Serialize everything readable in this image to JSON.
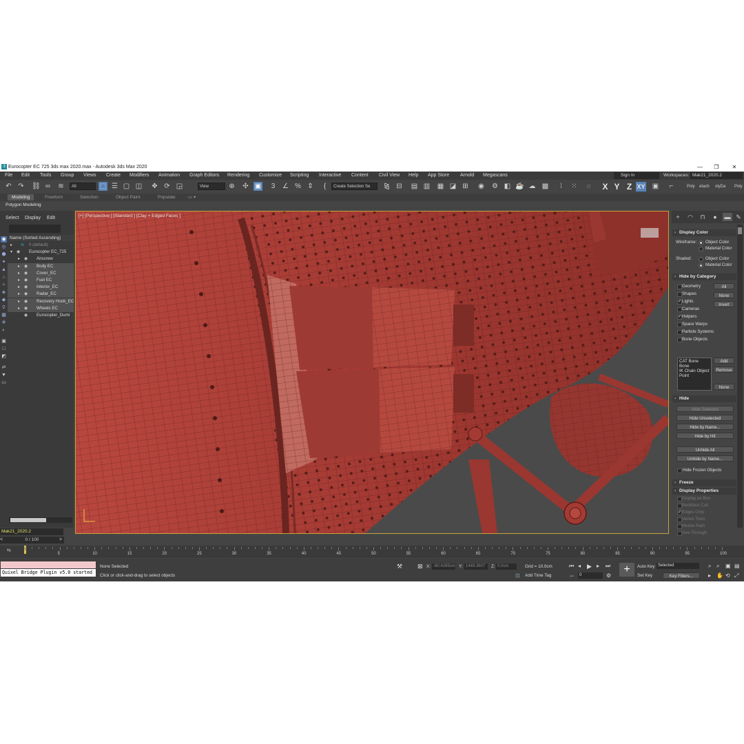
{
  "window": {
    "title": "Eurocopter EC 725 3ds max 2020.max - Autodesk 3ds Max 2020",
    "logo_letter": "3"
  },
  "window_controls": {
    "minimize": "—",
    "maximize": "❐",
    "close": "✕"
  },
  "menu": [
    "File",
    "Edit",
    "Tools",
    "Group",
    "Views",
    "Create",
    "Modifiers",
    "Animation",
    "Graph Editors",
    "Rendering",
    "Customize",
    "Scripting",
    "Interactive",
    "Content",
    "Civil View",
    "Help",
    "App Store",
    "Arnold",
    "Megascans"
  ],
  "account": {
    "signin": "Sign In",
    "workspaces_label": "Workspaces:",
    "workspace": "Mak21_2020.2"
  },
  "toolbar": {
    "filter": "All",
    "ref_coord": "View",
    "selection_set": "Create Selection Se",
    "axes": [
      "X",
      "Y",
      "Z",
      "XY"
    ],
    "active_axis": "XY",
    "ribbon_buttons": [
      "Poly",
      "etach",
      "olyDa",
      "Poly"
    ]
  },
  "ribbon": {
    "tabs": [
      "Modeling",
      "Freeform",
      "Selection",
      "Object Paint",
      "Populate"
    ],
    "active": "Modeling",
    "subtitle": "Polygon Modeling"
  },
  "scene_explorer": {
    "menus": [
      "Select",
      "Display",
      "Edit"
    ],
    "header": "Name (Sorted Ascending)",
    "rows": [
      {
        "label": "0 (default)",
        "depth": 0,
        "dim": true
      },
      {
        "label": "Eurocopter EC_725",
        "depth": 1,
        "dim": false
      },
      {
        "label": "Airscrew",
        "depth": 2,
        "dim": false
      },
      {
        "label": "Body EC",
        "depth": 2,
        "dim": false
      },
      {
        "label": "Cover_EC",
        "depth": 2,
        "dim": false
      },
      {
        "label": "Fuel EC",
        "depth": 2,
        "dim": false
      },
      {
        "label": "Interior_EC",
        "depth": 2,
        "dim": false
      },
      {
        "label": "Radar_EC",
        "depth": 2,
        "dim": false
      },
      {
        "label": "Recovery Hook_EC",
        "depth": 2,
        "dim": false
      },
      {
        "label": "Wheels EC",
        "depth": 2,
        "dim": false
      },
      {
        "label": "Eurocopter_Dumi",
        "depth": 2,
        "dim": false
      }
    ],
    "layer": "Mak21_2020.2"
  },
  "viewport": {
    "label": "[+] [Perspective ] [Standard ] [Clay + Edged Faces ]"
  },
  "command_panel": {
    "display_color": {
      "title": "Display Color",
      "wireframe_label": "Wireframe:",
      "shaded_label": "Shaded:",
      "object_color": "Object Color",
      "material_color": "Material Color"
    },
    "hide_by_category": {
      "title": "Hide by Category",
      "items": [
        {
          "label": "Geometry",
          "checked": false
        },
        {
          "label": "Shapes",
          "checked": false
        },
        {
          "label": "Lights",
          "checked": true
        },
        {
          "label": "Cameras",
          "checked": false
        },
        {
          "label": "Helpers",
          "checked": true
        },
        {
          "label": "Space Warps",
          "checked": false
        },
        {
          "label": "Particle Systems",
          "checked": false
        },
        {
          "label": "Bone Objects",
          "checked": false
        }
      ],
      "all": "All",
      "none": "None",
      "invert": "Invert",
      "list": [
        "CAT Bone",
        "Bone",
        "IK Chain Object",
        "Point"
      ],
      "add": "Add",
      "remove": "Remove",
      "none2": "None"
    },
    "hide": {
      "title": "Hide",
      "buttons": [
        {
          "label": "Hide Selected",
          "dim": true
        },
        {
          "label": "Hide Unselected",
          "dim": false
        },
        {
          "label": "Hide by Name...",
          "dim": false
        },
        {
          "label": "Hide by Hit",
          "dim": false
        },
        {
          "label": "Unhide All",
          "dim": false
        },
        {
          "label": "Unhide by Name...",
          "dim": false
        }
      ],
      "hide_frozen": "Hide Frozen Objects"
    },
    "freeze": {
      "title": "Freeze"
    },
    "display_properties": {
      "title": "Display Properties",
      "items": [
        {
          "label": "Display as Box",
          "checked": false
        },
        {
          "label": "Backface Cull",
          "checked": false
        },
        {
          "label": "Edges Only",
          "checked": true
        },
        {
          "label": "Vertex Ticks",
          "checked": false
        },
        {
          "label": "Motion Path",
          "checked": false
        },
        {
          "label": "See-Through",
          "checked": false
        }
      ]
    }
  },
  "timeline": {
    "slider": "0 / 100",
    "ticks": [
      "0",
      "5",
      "10",
      "15",
      "20",
      "25",
      "30",
      "35",
      "40",
      "45",
      "50",
      "55",
      "60",
      "65",
      "70",
      "75",
      "80",
      "85",
      "90",
      "95",
      "100"
    ]
  },
  "status": {
    "maxscript": "Quixel Bridge Plugin v5.0 started",
    "selection": "None Selected",
    "prompt": "Click or click-and-drag to select objects",
    "x_label": "X:",
    "x": "-80.4265cm",
    "y_label": "Y:",
    "y": "1449.3607",
    "z_label": "Z:",
    "z": "0.0cm",
    "grid": "Grid = 10.0cm",
    "add_time_tag": "Add Time Tag",
    "auto_key": "Auto Key",
    "selected": "Selected",
    "set_key": "Set Key",
    "key_filters": "Key Filters...",
    "frame": "0"
  },
  "colors": {
    "accent": "#5a84b8",
    "model_red": "#a33a33",
    "viewport_border": "#c7a23c"
  }
}
